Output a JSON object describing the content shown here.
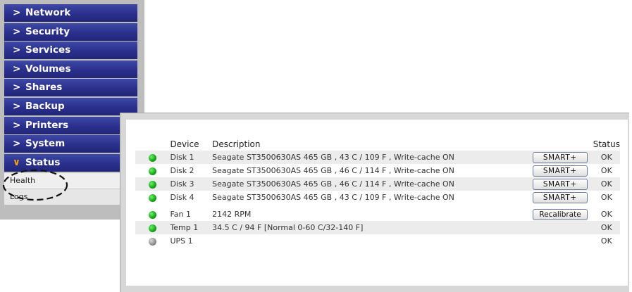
{
  "sidebar": {
    "menu": [
      {
        "label": "Network"
      },
      {
        "label": "Security"
      },
      {
        "label": "Services"
      },
      {
        "label": "Volumes"
      },
      {
        "label": "Shares"
      },
      {
        "label": "Backup"
      },
      {
        "label": "Printers"
      },
      {
        "label": "System"
      },
      {
        "label": "Status"
      }
    ],
    "status_submenu": [
      {
        "label": "Health"
      },
      {
        "label": "Logs"
      }
    ]
  },
  "health_table": {
    "headers": {
      "device": "Device",
      "description": "Description",
      "status": "Status"
    },
    "rows": [
      {
        "led": "green",
        "device": "Disk 1",
        "description": "Seagate ST3500630AS 465 GB , 43 C / 109 F , Write-cache ON",
        "action": "SMART+",
        "status": "OK"
      },
      {
        "led": "green",
        "device": "Disk 2",
        "description": "Seagate ST3500630AS 465 GB , 46 C / 114 F , Write-cache ON",
        "action": "SMART+",
        "status": "OK"
      },
      {
        "led": "green",
        "device": "Disk 3",
        "description": "Seagate ST3500630AS 465 GB , 46 C / 114 F , Write-cache ON",
        "action": "SMART+",
        "status": "OK"
      },
      {
        "led": "green",
        "device": "Disk 4",
        "description": "Seagate ST3500630AS 465 GB , 43 C / 109 F , Write-cache ON",
        "action": "SMART+",
        "status": "OK"
      },
      {
        "led": "green",
        "device": "Fan 1",
        "description": "2142 RPM",
        "action": "Recalibrate",
        "status": "OK"
      },
      {
        "led": "green",
        "device": "Temp 1",
        "description": "34.5 C / 94 F [Normal 0-60 C/32-140 F]",
        "action": "",
        "status": "OK"
      },
      {
        "led": "grey",
        "device": "UPS 1",
        "description": "",
        "action": "",
        "status": "OK"
      }
    ]
  },
  "icons": {
    "menu_chevron": "chevron-right-icon",
    "active_chevron": "chevron-down-icon",
    "status_led": "status-led-icon"
  },
  "colors": {
    "menu_bg": "#2a2f8c",
    "active_chevron": "#f2a21a",
    "led_ok": "#12a412",
    "led_unknown": "#8c8c8c",
    "highlight_ring": "#111111"
  }
}
